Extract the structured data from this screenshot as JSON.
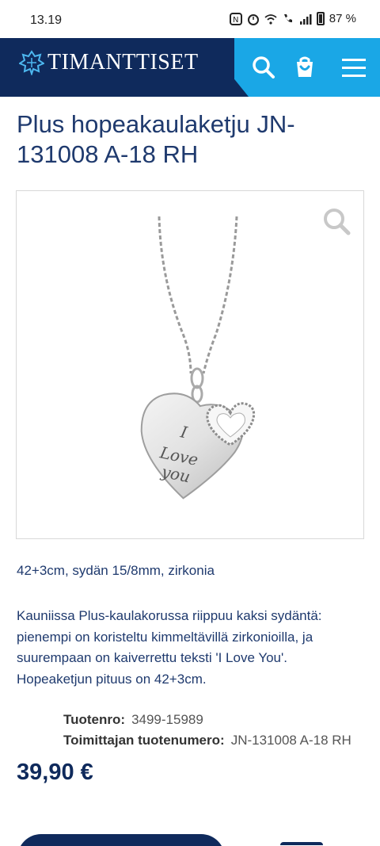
{
  "status_bar": {
    "time": "13.19",
    "battery": "87 %"
  },
  "header": {
    "logo_text": "Timanttiset",
    "icons": [
      "logo-mark-icon",
      "search-icon",
      "shopping-bag-icon",
      "hamburger-menu-icon"
    ],
    "colors": {
      "nav_bg": "#0f2a5c",
      "actions_bg": "#1aa7e6"
    }
  },
  "product": {
    "title": "Plus hopeakaulaketju JN-131008 A-18 RH",
    "image_engraving": [
      "I",
      "Love",
      "you"
    ],
    "short_description": "42+3cm, sydän 15/8mm, zirkonia",
    "long_description": "Kauniissa Plus-kaulakorussa riippuu kaksi sydäntä: pienempi on koristeltu kimmeltävillä zirkonioilla, ja suurempaan on kaiverrettu teksti 'I Love You'. Hopeaketjun pituus on 42+3cm.",
    "specs": [
      {
        "label": "Tuotenro:",
        "value": "3499-15989"
      },
      {
        "label": "Toimittajan tuotenumero:",
        "value": "JN-131008 A-18 RH"
      }
    ],
    "price": "39,90 €"
  }
}
